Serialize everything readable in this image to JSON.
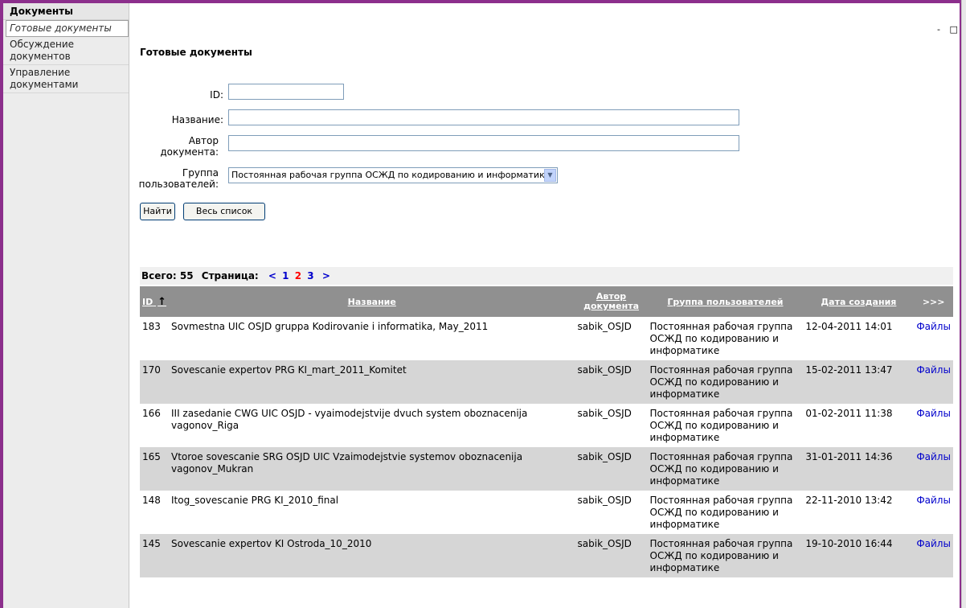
{
  "sidebar": {
    "header": "Документы",
    "items": [
      {
        "label": "Готовые документы"
      },
      {
        "label": "Обсуждение документов"
      },
      {
        "label": "Управление документами"
      }
    ]
  },
  "window_controls": {
    "minimize": "-",
    "maximize": "□"
  },
  "page": {
    "title": "Готовые документы"
  },
  "search_form": {
    "id_label": "ID:",
    "id_value": "",
    "name_label": "Название:",
    "name_value": "",
    "author_label_1": "Автор",
    "author_label_2": "документа:",
    "author_value": "",
    "group_label_1": "Группа",
    "group_label_2": "пользователей:",
    "group_selected": "Постоянная рабочая группа ОСЖД по кодированию и информатике",
    "find_button": "Найти",
    "all_button": "Весь список"
  },
  "summary": {
    "total_label": "Всего: 55",
    "page_label": "Страница:",
    "prev": "<",
    "pages": [
      "1",
      "2",
      "3"
    ],
    "current_page": "2",
    "next": ">"
  },
  "table": {
    "headers": {
      "id": "ID",
      "sort_icon": "↑",
      "name": "Название",
      "author": "Автор документа",
      "group": "Группа пользователей",
      "date": "Дата создания",
      "more": ">>>"
    },
    "rows": [
      {
        "id": "183",
        "name": "Sovmestna UIC OSJD gruppa Kodirovanie i informatika, May_2011",
        "author": "sabik_OSJD",
        "group": "Постоянная рабочая группа ОСЖД по кодированию и информатике",
        "date": "12-04-2011 14:01",
        "files": "Файлы"
      },
      {
        "id": "170",
        "name": "Sovescanie expertov PRG KI_mart_2011_Komitet",
        "author": "sabik_OSJD",
        "group": "Постоянная рабочая группа ОСЖД по кодированию и информатике",
        "date": "15-02-2011 13:47",
        "files": "Файлы"
      },
      {
        "id": "166",
        "name": "III zasedanie CWG UIC OSJD - vyaimodejstvije dvuch system oboznacenija vagonov_Riga",
        "author": "sabik_OSJD",
        "group": "Постоянная рабочая группа ОСЖД по кодированию и информатике",
        "date": "01-02-2011 11:38",
        "files": "Файлы"
      },
      {
        "id": "165",
        "name": "Vtoroe sovescanie SRG OSJD UIC Vzaimodejstvie systemov oboznacenija vagonov_Mukran",
        "author": "sabik_OSJD",
        "group": "Постоянная рабочая группа ОСЖД по кодированию и информатике",
        "date": "31-01-2011 14:36",
        "files": "Файлы"
      },
      {
        "id": "148",
        "name": "Itog_sovescanie PRG KI_2010_final",
        "author": "sabik_OSJD",
        "group": "Постоянная рабочая группа ОСЖД по кодированию и информатике",
        "date": "22-11-2010 13:42",
        "files": "Файлы"
      },
      {
        "id": "145",
        "name": "Sovescanie expertov KI Ostroda_10_2010",
        "author": "sabik_OSJD",
        "group": "Постоянная рабочая группа ОСЖД по кодированию и информатике",
        "date": "19-10-2010 16:44",
        "files": "Файлы"
      }
    ]
  }
}
